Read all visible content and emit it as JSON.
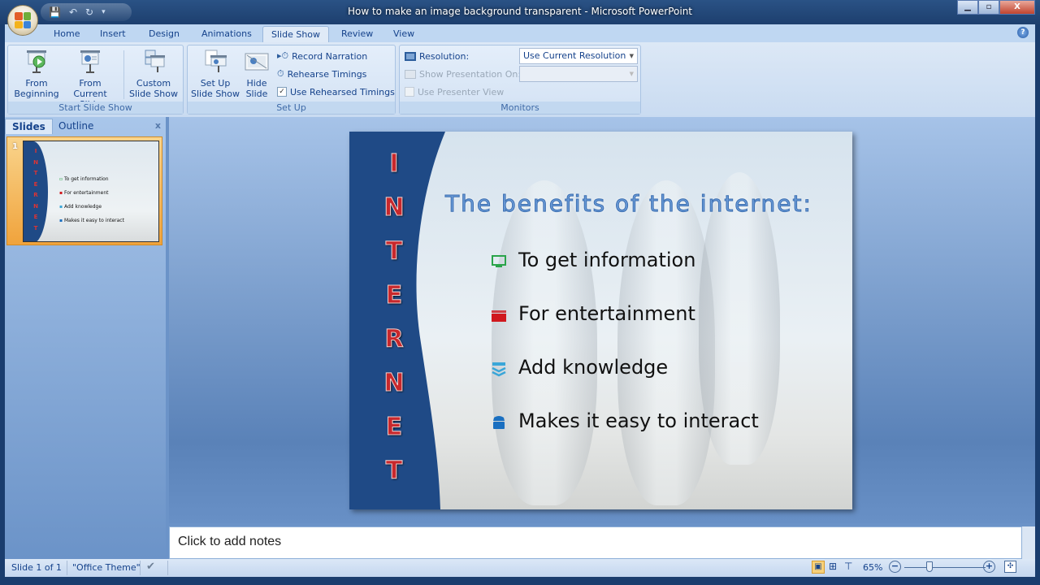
{
  "window": {
    "title": "How to make an image background transparent - Microsoft PowerPoint",
    "controls": [
      "minimize",
      "restore",
      "close"
    ]
  },
  "quick_access": [
    "save-icon",
    "undo-icon",
    "redo-icon",
    "customize-icon"
  ],
  "tabs": [
    {
      "label": "Home",
      "active": false
    },
    {
      "label": "Insert",
      "active": false
    },
    {
      "label": "Design",
      "active": false
    },
    {
      "label": "Animations",
      "active": false
    },
    {
      "label": "Slide Show",
      "active": true
    },
    {
      "label": "Review",
      "active": false
    },
    {
      "label": "View",
      "active": false
    }
  ],
  "ribbon": {
    "start_slide_show": {
      "label": "Start Slide Show",
      "from_beginning": [
        "From",
        "Beginning"
      ],
      "from_current": [
        "From",
        "Current Slide"
      ],
      "custom": [
        "Custom",
        "Slide Show ▾"
      ]
    },
    "set_up": {
      "label": "Set Up",
      "set_up_show": [
        "Set Up",
        "Slide Show"
      ],
      "hide_slide": [
        "Hide",
        "Slide"
      ],
      "record_narration": "Record Narration",
      "rehearse_timings": "Rehearse Timings",
      "use_rehearsed": "Use Rehearsed Timings",
      "use_rehearsed_checked": true
    },
    "monitors": {
      "label": "Monitors",
      "resolution_label": "Resolution:",
      "resolution_value": "Use Current Resolution",
      "show_on_label": "Show Presentation On:",
      "show_on_value": "",
      "presenter_view": "Use Presenter View",
      "presenter_view_checked": false
    }
  },
  "panel": {
    "tabs": [
      "Slides",
      "Outline"
    ],
    "active_tab": "Slides",
    "close": "x",
    "thumbnails": [
      {
        "number": "1",
        "lines": [
          "To get information",
          "For entertainment",
          "Add knowledge",
          "Makes it easy to interact"
        ]
      }
    ]
  },
  "slide": {
    "vertical_word": [
      "I",
      "N",
      "T",
      "E",
      "R",
      "N",
      "E",
      "T"
    ],
    "heading": "The benefits of the internet:",
    "bullets": [
      {
        "text": "To get information",
        "icon": "monitor-icon",
        "color": "#2aa44a"
      },
      {
        "text": "For entertainment",
        "icon": "clapperboard-icon",
        "color": "#d0181e"
      },
      {
        "text": "Add knowledge",
        "icon": "books-icon",
        "color": "#3aa6d8"
      },
      {
        "text": "Makes it easy to interact",
        "icon": "telephone-icon",
        "color": "#1a6fc0"
      }
    ],
    "sidebar_color": "#1f4a86",
    "letter_color": "#c8282c"
  },
  "notes": {
    "placeholder": "Click to add notes"
  },
  "status": {
    "slide": "Slide 1 of 1",
    "theme": "\"Office Theme\"",
    "zoom": "65%",
    "zoom_percent": 65
  }
}
